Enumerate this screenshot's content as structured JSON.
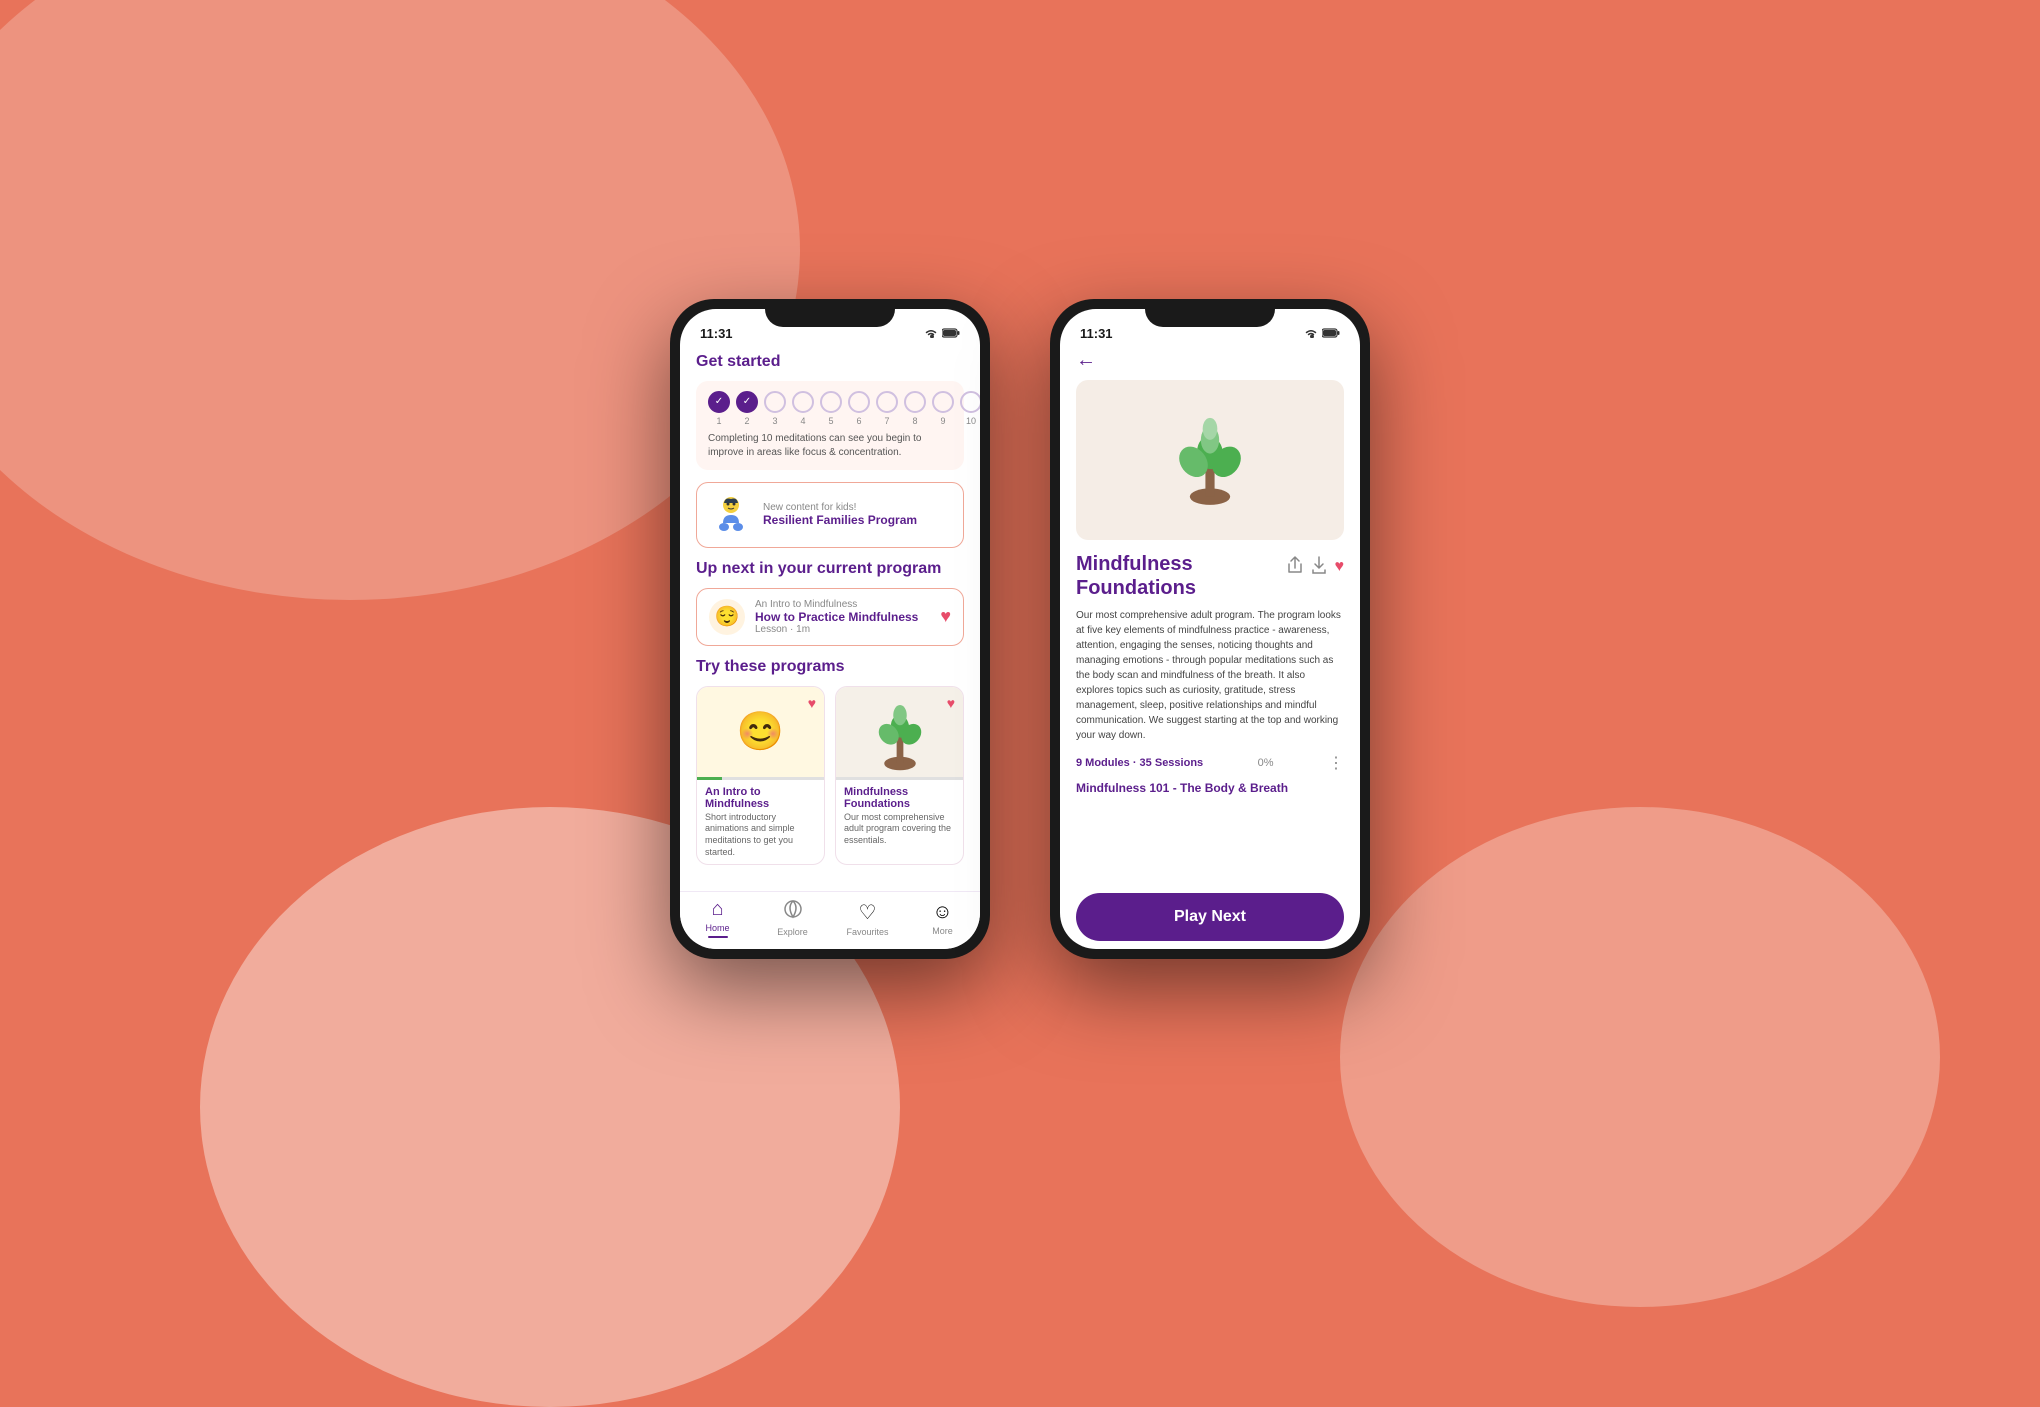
{
  "background": {
    "color": "#e8735a"
  },
  "left_phone": {
    "status_bar": {
      "time": "11:31",
      "wifi": "wifi",
      "battery": "battery"
    },
    "get_started": {
      "title": "Get started",
      "progress": {
        "completed": 2,
        "total": 10,
        "description": "Completing 10 meditations can see you begin to improve in areas like focus & concentration."
      }
    },
    "kids_card": {
      "subtitle": "New content for kids!",
      "title": "Resilient Families Program"
    },
    "up_next": {
      "section_title": "Up next in your current program",
      "lesson_subtitle": "An Intro to Mindfulness",
      "lesson_title": "How to Practice Mindfulness",
      "lesson_meta": "Lesson · 1m"
    },
    "try_programs": {
      "section_title": "Try these programs",
      "programs": [
        {
          "title": "An Intro to Mindfulness",
          "description": "Short introductory animations and simple meditations to get you started.",
          "progress": 20
        },
        {
          "title": "Mindfulness Foundations",
          "description": "Our most comprehensive adult program covering the essentials.",
          "progress": 0
        }
      ]
    },
    "bottom_nav": {
      "items": [
        {
          "label": "Home",
          "active": true
        },
        {
          "label": "Explore",
          "active": false
        },
        {
          "label": "Favourites",
          "active": false
        },
        {
          "label": "More",
          "active": false
        }
      ]
    }
  },
  "right_phone": {
    "status_bar": {
      "time": "11:31"
    },
    "detail": {
      "title": "Mindfulness\nFoundations",
      "description": "Our most comprehensive adult program. The program looks at five key elements of mindfulness practice - awareness, attention, engaging the senses, noticing thoughts and managing emotions - through popular meditations such as the body scan and mindfulness of the breath. It also explores topics such as curiosity, gratitude, stress management, sleep, positive relationships and mindful communication. We suggest starting at the top and working your way down.",
      "meta": "9 Modules · 35 Sessions",
      "progress_pct": "0%",
      "module_title": "Mindfulness 101 - The Body & Breath",
      "play_next_label": "Play Next"
    }
  }
}
